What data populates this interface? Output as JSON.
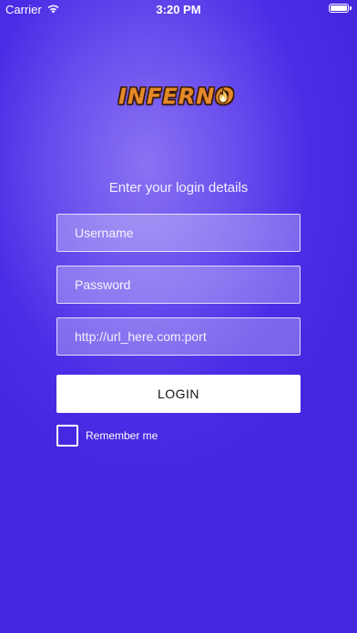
{
  "status_bar": {
    "carrier": "Carrier",
    "time": "3:20 PM",
    "icons": [
      "wifi-icon",
      "battery-icon"
    ]
  },
  "logo": {
    "text": "INFERNO",
    "icon": "flame-icon",
    "colors": {
      "fill": "#e58a2a",
      "outline": "#3a1a08"
    }
  },
  "login": {
    "prompt": "Enter your login details",
    "username_placeholder": "Username",
    "password_placeholder": "Password",
    "url_placeholder": "http://url_here.com:port",
    "button_label": "LOGIN",
    "remember_label": "Remember me",
    "remember_checked": false
  },
  "colors": {
    "background": "#4a2ee6",
    "background_glow": "#8a72f2",
    "button_background": "#ffffff",
    "button_text": "#111111"
  }
}
